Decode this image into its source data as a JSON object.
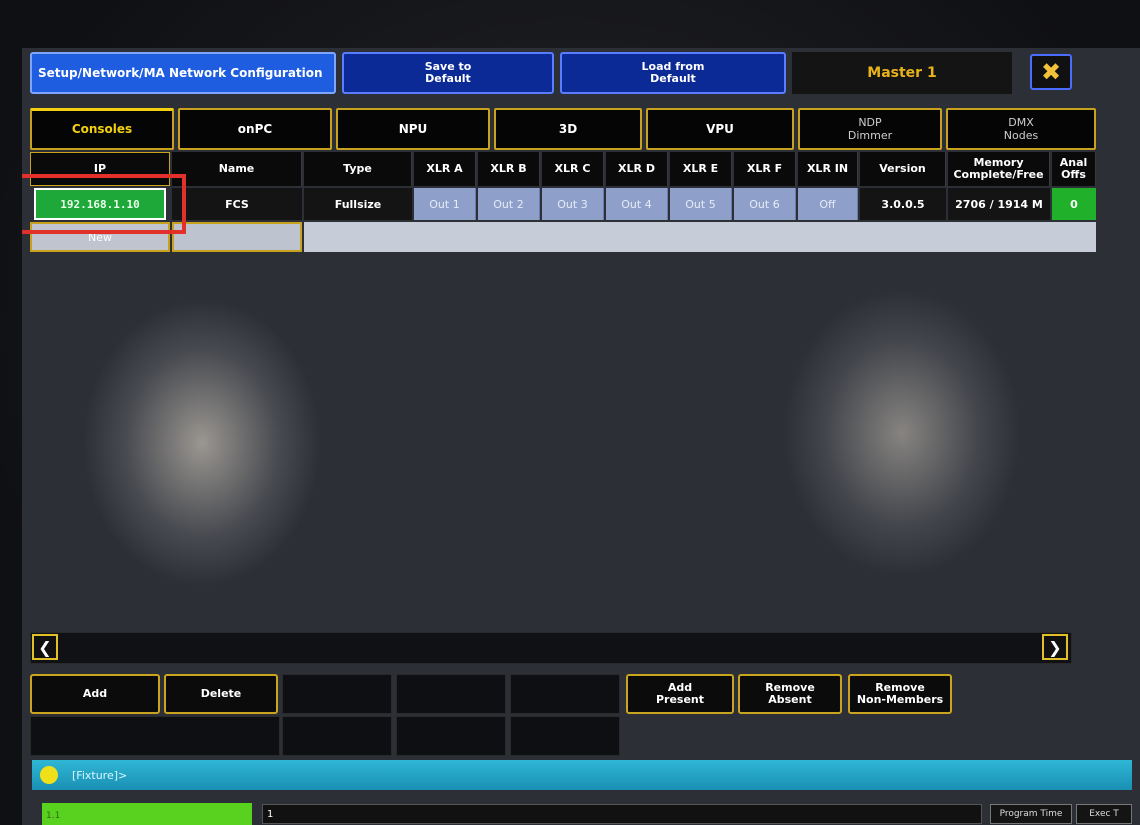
{
  "window": {
    "title": "Setup/Network/MA Network Configuration",
    "save_label": "Save to\nDefault",
    "load_label": "Load from\nDefault",
    "master_label": "Master 1",
    "close_icon": "close-icon"
  },
  "tabs": [
    {
      "label": "Consoles",
      "active": true
    },
    {
      "label": "onPC"
    },
    {
      "label": "NPU"
    },
    {
      "label": "3D"
    },
    {
      "label": "VPU"
    },
    {
      "label": "NDP\nDimmer"
    },
    {
      "label": "DMX\nNodes"
    }
  ],
  "table": {
    "headers": [
      "IP",
      "Name",
      "Type",
      "XLR A",
      "XLR B",
      "XLR C",
      "XLR D",
      "XLR E",
      "XLR F",
      "XLR IN",
      "Version",
      "Memory\nComplete/Free",
      "Anal\nOffs"
    ],
    "row": {
      "ip": "192.168.1.10",
      "name": "FCS",
      "type": "Fullsize",
      "xlr": [
        "Out 1",
        "Out 2",
        "Out 3",
        "Out 4",
        "Out 5",
        "Out 6"
      ],
      "xlr_in": "Off",
      "version": "3.0.0.5",
      "memory": "2706 / 1914 M",
      "analog": "0"
    },
    "new_label": "New"
  },
  "buttons": {
    "add": "Add",
    "delete": "Delete",
    "add_present": "Add\nPresent",
    "remove_absent": "Remove\nAbsent",
    "remove_non_members": "Remove\nNon-Members"
  },
  "command_line": {
    "text": "[Fixture]>"
  },
  "status": {
    "left_code": "1.1",
    "input_value": "1",
    "program_time": "Program Time",
    "exec_time": "Exec T"
  },
  "colors": {
    "highlight_box": "#e2302a",
    "ip_cell": "#1ea83a",
    "output_cells": "#8ea0c9",
    "accent_yellow": "#c8a21c"
  }
}
